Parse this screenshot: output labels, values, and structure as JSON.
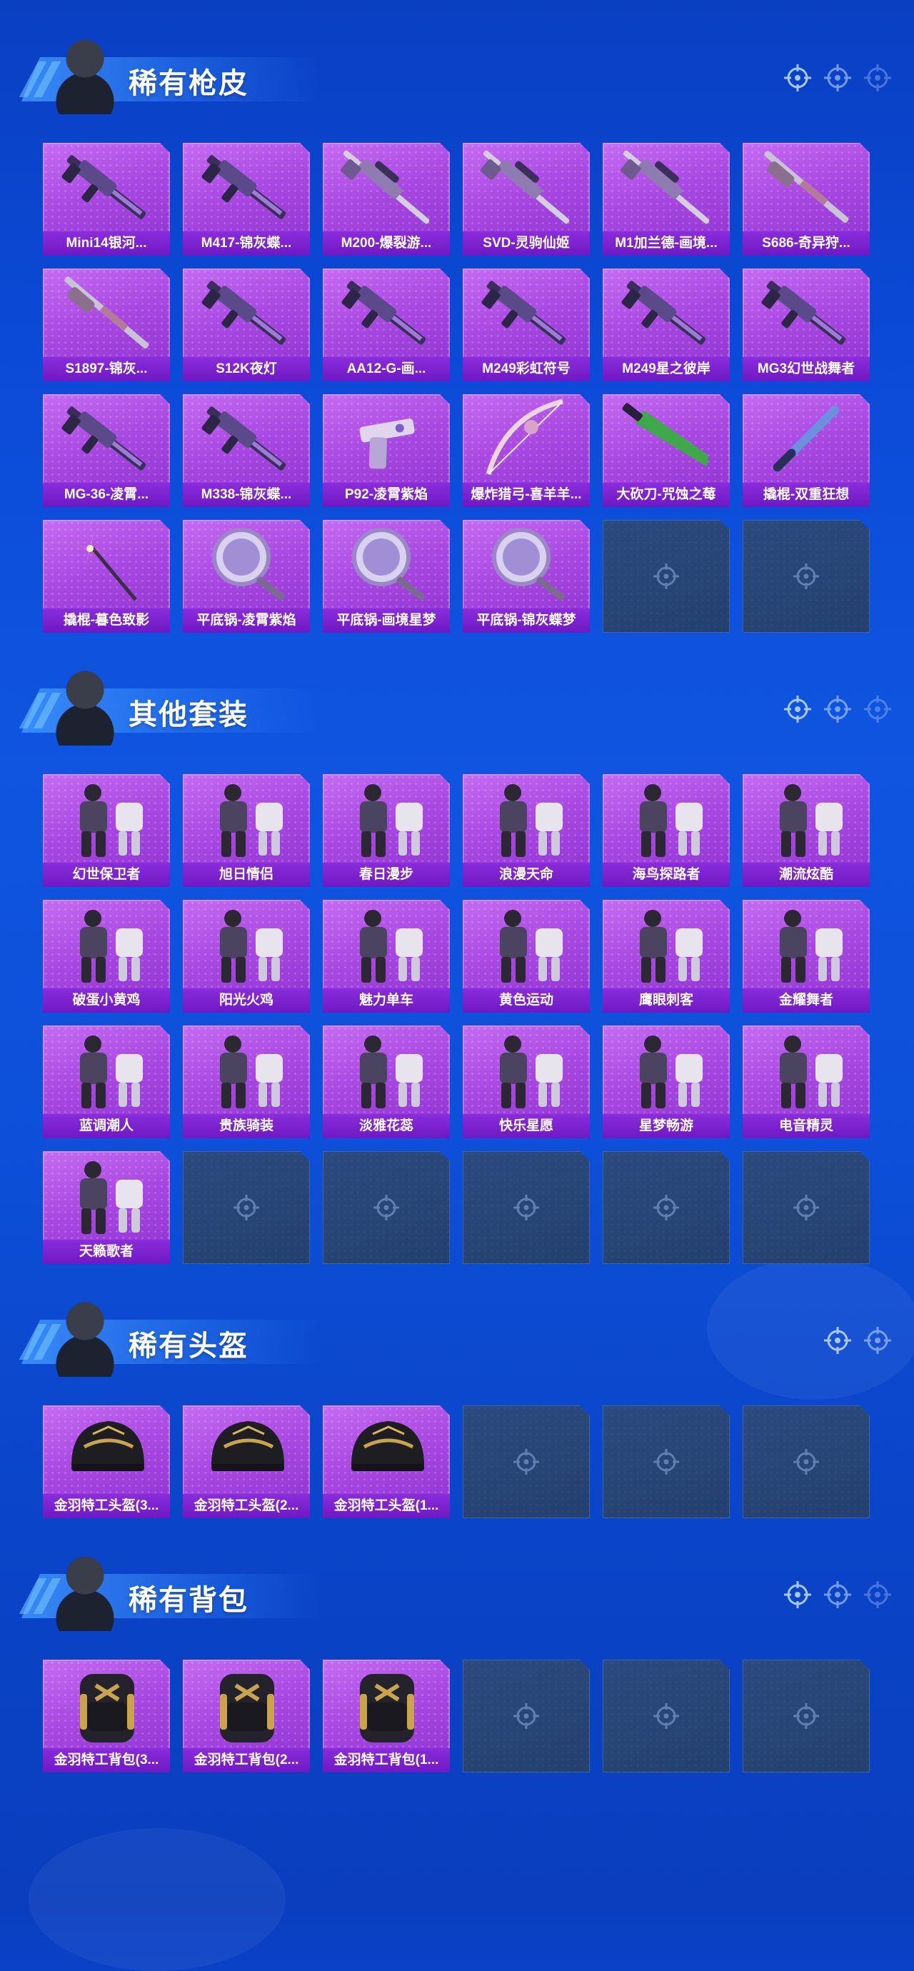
{
  "sections": [
    {
      "title": "稀有枪皮",
      "items": [
        {
          "label": "Mini14银河...",
          "art": "gun"
        },
        {
          "label": "M417-锦灰蝶...",
          "art": "gun"
        },
        {
          "label": "M200-爆裂游...",
          "art": "sniper"
        },
        {
          "label": "SVD-灵驹仙姬",
          "art": "sniper"
        },
        {
          "label": "M1加兰德-画境...",
          "art": "sniper"
        },
        {
          "label": "S686-奇异狩...",
          "art": "shotgun"
        },
        {
          "label": "S1897-锦灰...",
          "art": "shotgun"
        },
        {
          "label": "S12K夜灯",
          "art": "gun"
        },
        {
          "label": "AA12-G-画...",
          "art": "gun"
        },
        {
          "label": "M249彩虹符号",
          "art": "gun"
        },
        {
          "label": "M249星之彼岸",
          "art": "gun"
        },
        {
          "label": "MG3幻世战舞者",
          "art": "gun"
        },
        {
          "label": "MG-36-凌霄...",
          "art": "gun"
        },
        {
          "label": "M338-锦灰蝶...",
          "art": "gun"
        },
        {
          "label": "P92-凌霄紫焰",
          "art": "pistol"
        },
        {
          "label": "爆炸猎弓-喜羊羊...",
          "art": "bow"
        },
        {
          "label": "大砍刀-咒蚀之莓",
          "art": "blade"
        },
        {
          "label": "撬棍-双重狂想",
          "art": "bat"
        },
        {
          "label": "撬棍-暮色致影",
          "art": "pinwheel"
        },
        {
          "label": "平底锅-凌霄紫焰",
          "art": "pan"
        },
        {
          "label": "平底锅-画境星梦",
          "art": "pan"
        },
        {
          "label": "平底锅-锦灰蝶梦",
          "art": "pan"
        },
        null,
        null
      ]
    },
    {
      "title": "其他套装",
      "items": [
        {
          "label": "幻世保卫者",
          "art": "outfit"
        },
        {
          "label": "旭日情侣",
          "art": "outfit"
        },
        {
          "label": "春日漫步",
          "art": "outfit"
        },
        {
          "label": "浪漫天命",
          "art": "outfit"
        },
        {
          "label": "海鸟探路者",
          "art": "outfit"
        },
        {
          "label": "潮流炫酷",
          "art": "outfit"
        },
        {
          "label": "破蛋小黄鸡",
          "art": "outfit"
        },
        {
          "label": "阳光火鸡",
          "art": "outfit"
        },
        {
          "label": "魅力单车",
          "art": "outfit"
        },
        {
          "label": "黄色运动",
          "art": "outfit"
        },
        {
          "label": "鹰眼刺客",
          "art": "outfit"
        },
        {
          "label": "金耀舞者",
          "art": "outfit"
        },
        {
          "label": "蓝调潮人",
          "art": "outfit"
        },
        {
          "label": "贵族骑装",
          "art": "outfit"
        },
        {
          "label": "淡雅花蕊",
          "art": "outfit"
        },
        {
          "label": "快乐星愿",
          "art": "outfit"
        },
        {
          "label": "星梦畅游",
          "art": "outfit"
        },
        {
          "label": "电音精灵",
          "art": "outfit"
        },
        {
          "label": "天籁歌者",
          "art": "outfit"
        },
        null,
        null,
        null,
        null,
        null
      ]
    },
    {
      "title": "稀有头盔",
      "items": [
        {
          "label": "金羽特工头盔(3...",
          "art": "helmet"
        },
        {
          "label": "金羽特工头盔(2...",
          "art": "helmet"
        },
        {
          "label": "金羽特工头盔(1...",
          "art": "helmet"
        },
        null,
        null,
        null
      ]
    },
    {
      "title": "稀有背包",
      "items": [
        {
          "label": "金羽特工背包(3...",
          "art": "backpack"
        },
        {
          "label": "金羽特工背包(2...",
          "art": "backpack"
        },
        {
          "label": "金羽特工背包(1...",
          "art": "backpack"
        },
        null,
        null,
        null
      ]
    }
  ],
  "colors": {
    "card": "#a949e2",
    "label_bar": "#7a20d0",
    "empty_card": "#273f6e",
    "background": "#0b4ad6"
  }
}
